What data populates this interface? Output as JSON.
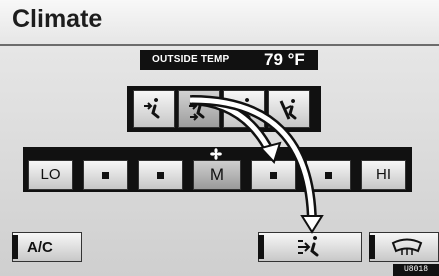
{
  "header": {
    "title": "Climate"
  },
  "outside_temp": {
    "label": "OUTSIDE TEMP",
    "value": "79 °F"
  },
  "airflow_modes": [
    {
      "icon": "airflow-face-icon",
      "selected": false
    },
    {
      "icon": "airflow-face-feet-icon",
      "selected": true
    },
    {
      "icon": "airflow-feet-icon",
      "selected": false
    },
    {
      "icon": "airflow-feet-windshield-icon",
      "selected": false
    }
  ],
  "fan": {
    "icon": "fan-icon",
    "buttons": [
      {
        "label": "LO"
      },
      {
        "label": ""
      },
      {
        "label": ""
      },
      {
        "label": "M",
        "selected": true
      },
      {
        "label": ""
      },
      {
        "label": ""
      },
      {
        "label": "HI"
      }
    ]
  },
  "bottom": {
    "ac_label": "A/C",
    "recirc_icon": "recirculation-icon",
    "defrost_icon": "front-defroster-icon"
  },
  "badge": "U8018"
}
